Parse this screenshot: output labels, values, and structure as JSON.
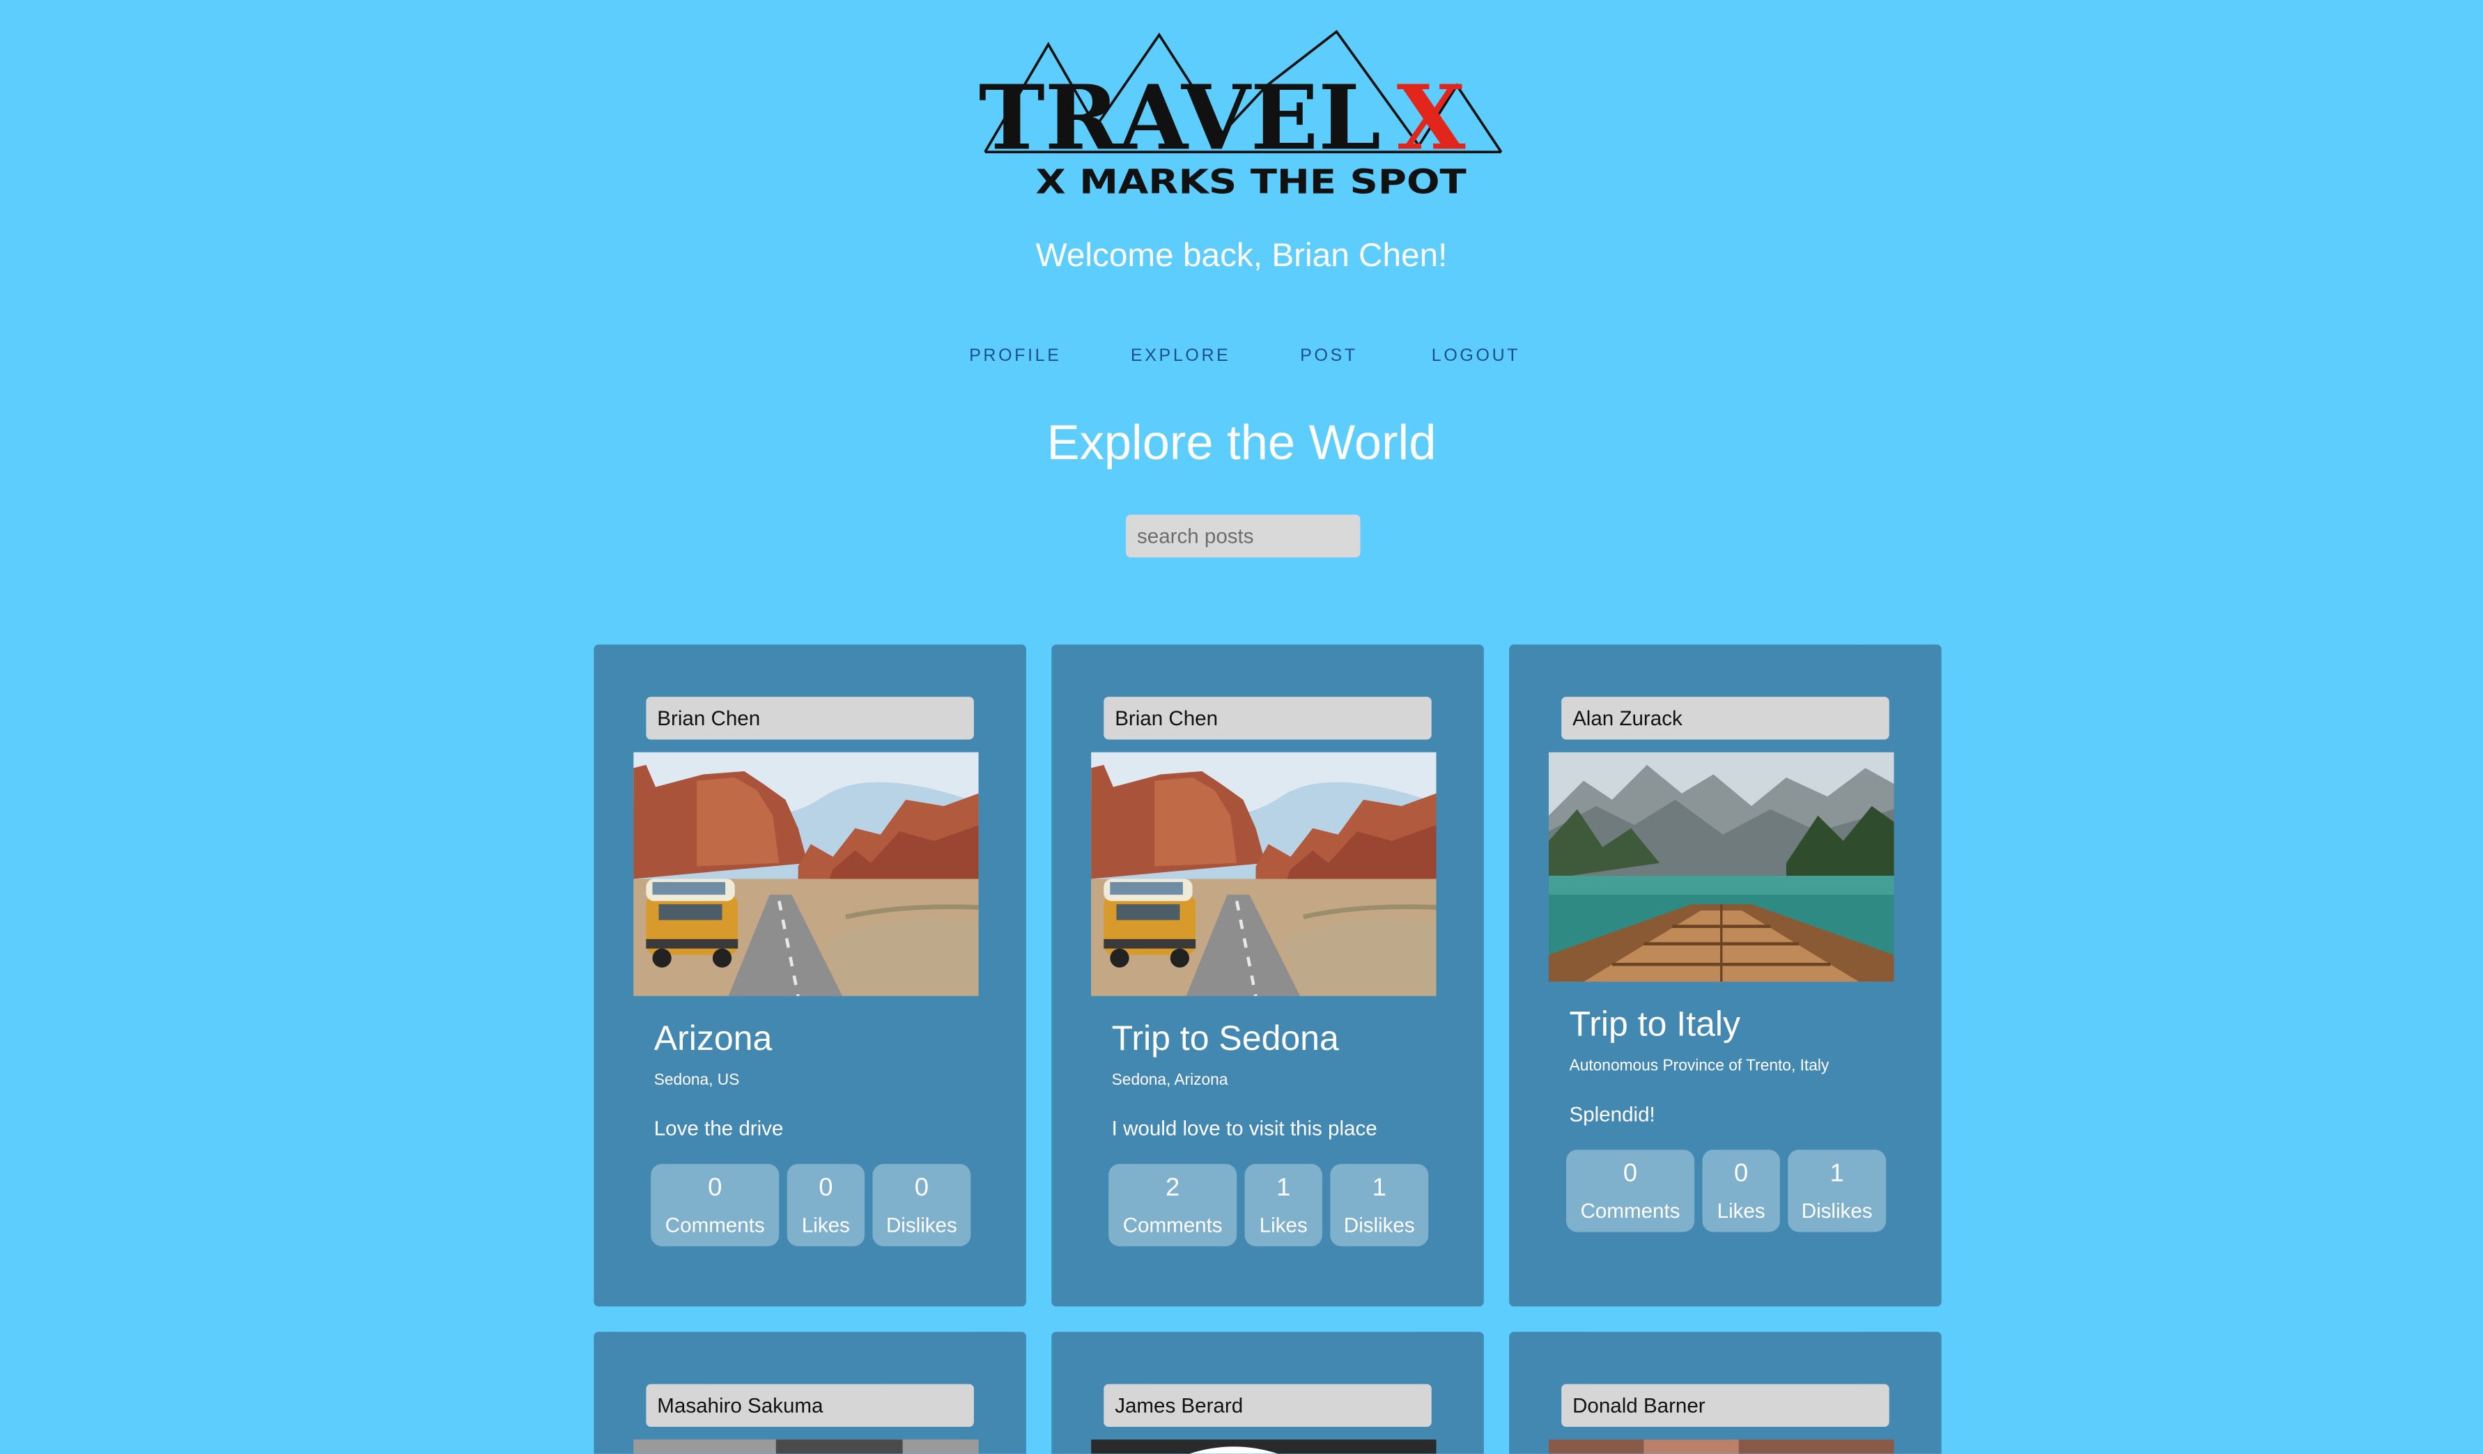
{
  "brand": {
    "logo_text": "TRAVELX",
    "logo_tagline": "X MARKS THE SPOT"
  },
  "header": {
    "welcome": "Welcome back, Brian Chen!"
  },
  "nav": {
    "profile": "PROFILE",
    "explore": "EXPLORE",
    "post": "POST",
    "logout": "LOGOUT"
  },
  "page": {
    "heading": "Explore the World"
  },
  "search": {
    "placeholder": "search posts"
  },
  "posts": [
    {
      "author": "Brian Chen",
      "title": "Arizona",
      "location": "Sedona, US",
      "description": "Love the drive",
      "comments": "0",
      "likes": "0",
      "dislikes": "0",
      "image": "desert-road-van"
    },
    {
      "author": "Brian Chen",
      "title": "Trip to Sedona",
      "location": "Sedona, Arizona",
      "description": "I would love to visit this place",
      "comments": "2",
      "likes": "1",
      "dislikes": "1",
      "image": "desert-road-van"
    },
    {
      "author": "Alan Zurack",
      "title": "Trip to Italy",
      "location": "Autonomous Province of Trento, Italy",
      "description": "Splendid!",
      "comments": "0",
      "likes": "0",
      "dislikes": "1",
      "image": "mountain-lake-boat"
    },
    {
      "author": "Masahiro Sakuma"
    },
    {
      "author": "James Berard"
    },
    {
      "author": "Donald Barner"
    }
  ],
  "stat_labels": {
    "comments": "Comments",
    "likes": "Likes",
    "dislikes": "Dislikes"
  },
  "colors": {
    "background": "#5ccdfc",
    "card": "#4288b0",
    "stat_pill": "#7fb0cc",
    "nav_link": "#1c4f8c",
    "logo_x": "#e3261c"
  }
}
